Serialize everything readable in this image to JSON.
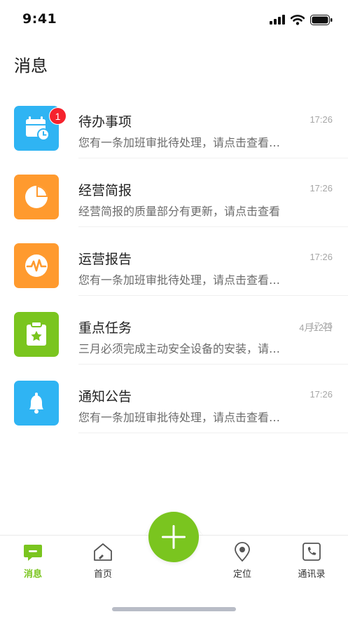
{
  "status_bar": {
    "time": "9:41"
  },
  "page": {
    "title": "消息"
  },
  "messages": [
    {
      "title": "待办事项",
      "preview": "您有一条加班审批待处理，请点击查看…",
      "time": "17:26",
      "badge": "1",
      "color": "#2fb4f3",
      "icon": "calendar-clock-icon"
    },
    {
      "title": "经营简报",
      "preview": "经营简报的质量部分有更新，请点击查看",
      "time": "17:26",
      "color": "#ff9a2e",
      "icon": "pie-chart-icon"
    },
    {
      "title": "运营报告",
      "preview": "您有一条加班审批待处理，请点击查看…",
      "time": "17:26",
      "color": "#ff9a2e",
      "icon": "pulse-icon"
    },
    {
      "title": "重点任务",
      "preview": "三月必须完成主动安全设备的安装，请…",
      "time": "4月12日",
      "time_overlap": "17:26",
      "color": "#7ac51f",
      "icon": "clipboard-star-icon"
    },
    {
      "title": "通知公告",
      "preview": "您有一条加班审批待处理，请点击查看…",
      "time": "17:26",
      "color": "#2fb4f3",
      "icon": "bell-icon"
    }
  ],
  "tab_bar": {
    "active_color": "#7ac51f",
    "items": [
      {
        "label": "消息",
        "icon": "message-icon",
        "active": true
      },
      {
        "label": "首页",
        "icon": "home-icon",
        "active": false
      },
      {
        "label": "定位",
        "icon": "location-pin-icon",
        "active": false
      },
      {
        "label": "通讯录",
        "icon": "phone-book-icon",
        "active": false
      }
    ],
    "fab_icon": "plus-icon"
  }
}
